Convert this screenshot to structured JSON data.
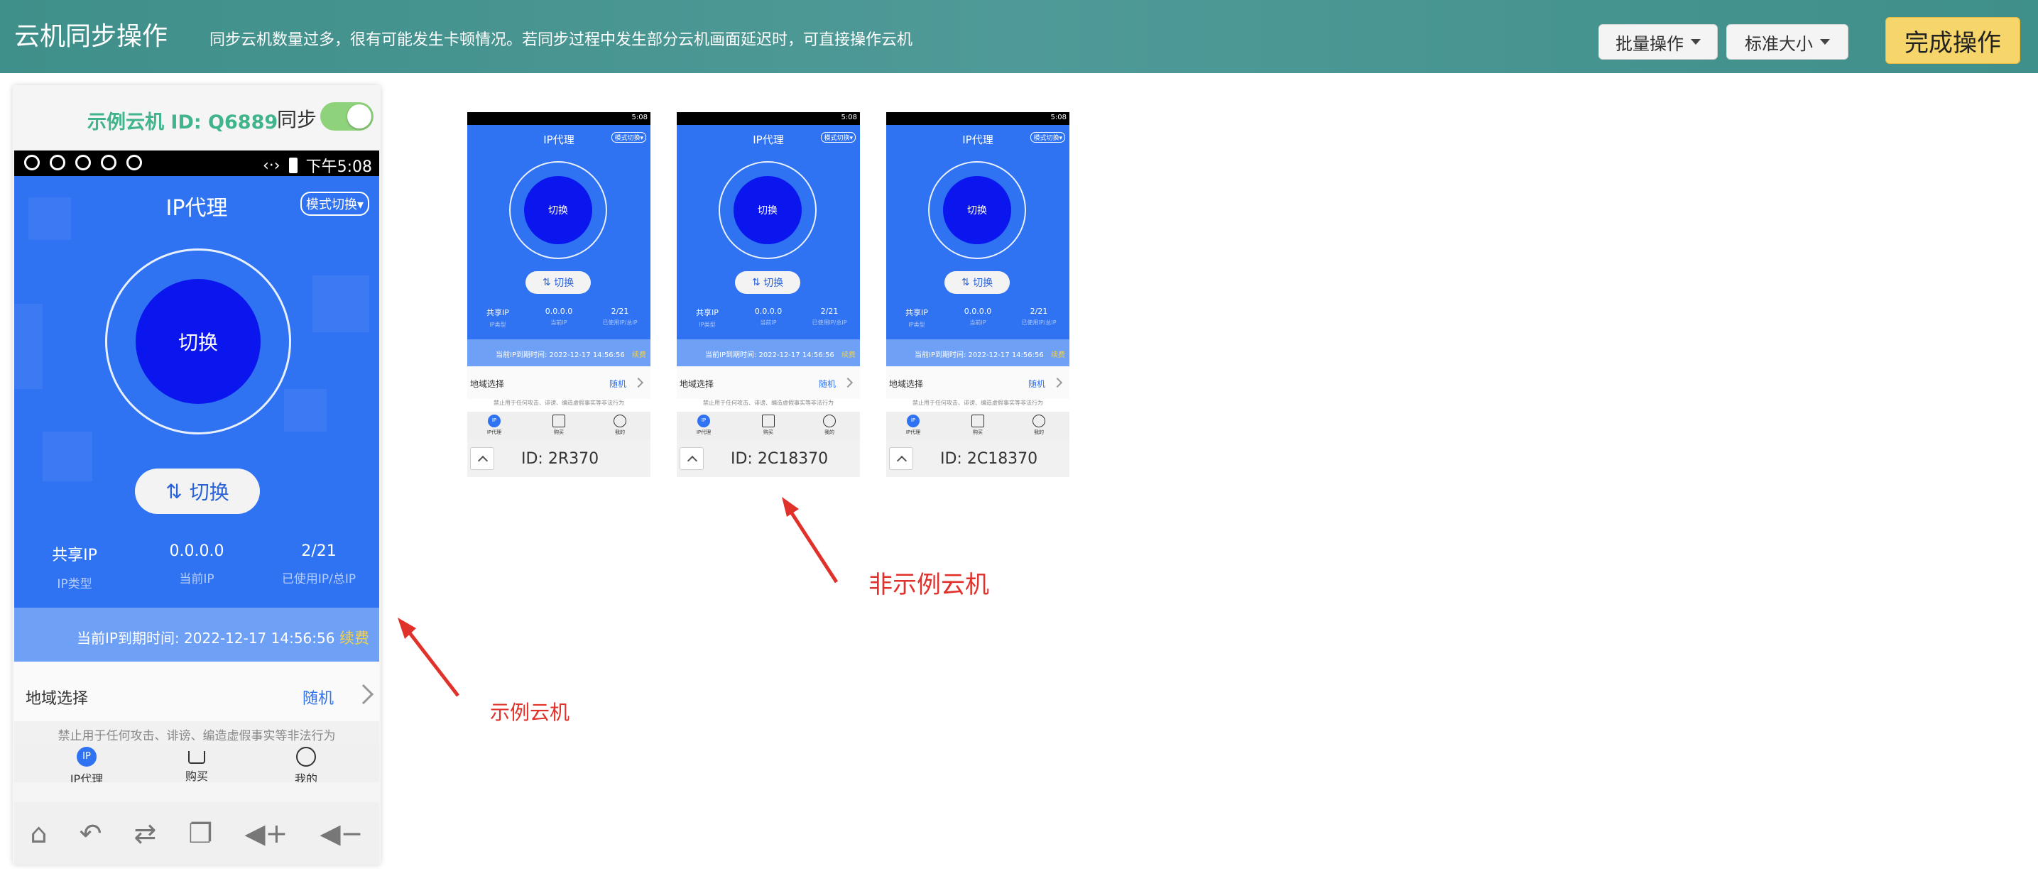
{
  "header": {
    "title": "云机同步操作",
    "notice": "同步云机数量过多，很有可能发生卡顿情况。若同步过程中发生部分云机画面延迟时，可直接操作云机",
    "batch_label": "批量操作",
    "size_label": "标准大小",
    "finish_label": "完成操作"
  },
  "main_device": {
    "id_label": "示例云机 ID: Q6889",
    "sync_label": "同步",
    "sync_on": true,
    "status_time": "下午5:08",
    "screen": {
      "title": "IP代理",
      "mode_switch": "模式切换▾",
      "core_label": "切换",
      "switch_button": "切换",
      "stats": [
        {
          "value": "共享IP",
          "label": "IP类型"
        },
        {
          "value": "0.0.0.0",
          "label": "当前IP"
        },
        {
          "value": "2/21",
          "label": "已使用IP/总IP"
        }
      ],
      "expiry": "当前IP到期时间:  2022-12-17 14:56:56",
      "renew": "续费",
      "region_label": "地域选择",
      "region_value": "随机",
      "disclaimer": "禁止用于任何攻击、诽谤、编造虚假事实等非法行为",
      "tabs": [
        {
          "icon": "IP",
          "label": "IP代理"
        },
        {
          "label": "购买"
        },
        {
          "label": "我的"
        }
      ]
    }
  },
  "thumbnails": [
    {
      "id_text": "ID:  2R370",
      "time": "5:08",
      "title": "IP代理",
      "mode": "模式切换▾",
      "core": "切换",
      "btn": "切换",
      "stats": [
        {
          "v": "共享IP",
          "l": "IP类型"
        },
        {
          "v": "0.0.0.0",
          "l": "当前IP"
        },
        {
          "v": "2/21",
          "l": "已使用IP/总IP"
        }
      ],
      "expiry": "当前IP到期时间:  2022-12-17 14:56:56",
      "renew": "续费",
      "region": "地域选择",
      "region_val": "随机",
      "disclaimer": "禁止用于任何攻击、诽谤、编造虚假事实等非法行为",
      "tab_icon": "IP",
      "tabs": [
        "IP代理",
        "购买",
        "我的"
      ]
    },
    {
      "id_text": "ID:  2C18370",
      "time": "5:08",
      "title": "IP代理",
      "mode": "模式切换▾",
      "core": "切换",
      "btn": "切换",
      "stats": [
        {
          "v": "共享IP",
          "l": "IP类型"
        },
        {
          "v": "0.0.0.0",
          "l": "当前IP"
        },
        {
          "v": "2/21",
          "l": "已使用IP/总IP"
        }
      ],
      "expiry": "当前IP到期时间:  2022-12-17 14:56:56",
      "renew": "续费",
      "region": "地域选择",
      "region_val": "随机",
      "disclaimer": "禁止用于任何攻击、诽谤、编造虚假事实等非法行为",
      "tab_icon": "IP",
      "tabs": [
        "IP代理",
        "购买",
        "我的"
      ]
    },
    {
      "id_text": "ID:  2C18370",
      "time": "5:08",
      "title": "IP代理",
      "mode": "模式切换▾",
      "core": "切换",
      "btn": "切换",
      "stats": [
        {
          "v": "共享IP",
          "l": "IP类型"
        },
        {
          "v": "0.0.0.0",
          "l": "当前IP"
        },
        {
          "v": "2/21",
          "l": "已使用IP/总IP"
        }
      ],
      "expiry": "当前IP到期时间:  2022-12-17 14:56:56",
      "renew": "续费",
      "region": "地域选择",
      "region_val": "随机",
      "disclaimer": "禁止用于任何攻击、诽谤、编造虚假事实等非法行为",
      "tab_icon": "IP",
      "tabs": [
        "IP代理",
        "购买",
        "我的"
      ]
    }
  ],
  "annotations": {
    "example_label": "示例云机",
    "non_example_label": "非示例云机"
  },
  "colors": {
    "header_bg": "#4a9591",
    "accent_blue": "#2f72f2",
    "core_blue": "#0b16ef",
    "finish_yellow": "#f6d56a",
    "annotation_red": "#e0322b",
    "id_green": "#40b48a"
  }
}
